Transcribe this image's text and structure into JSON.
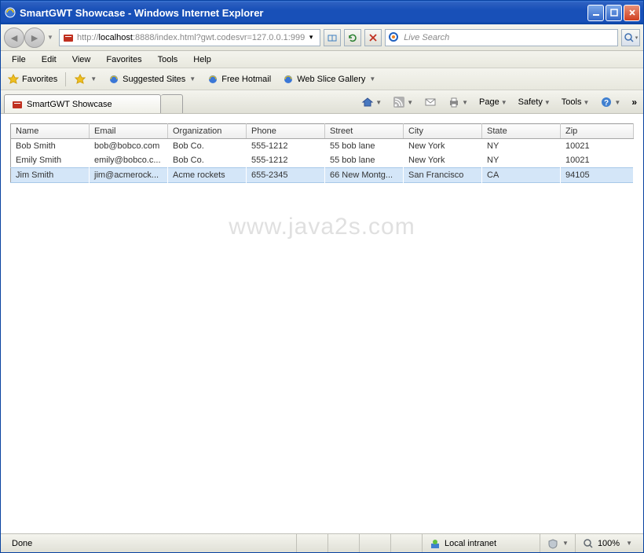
{
  "window": {
    "title": "SmartGWT Showcase - Windows Internet Explorer"
  },
  "nav": {
    "url_prefix": "http://",
    "url_host": "localhost",
    "url_suffix": ":8888/index.html?gwt.codesvr=127.0.0.1:999",
    "search_placeholder": "Live Search"
  },
  "menubar": {
    "file": "File",
    "edit": "Edit",
    "view": "View",
    "favorites": "Favorites",
    "tools": "Tools",
    "help": "Help"
  },
  "favbar": {
    "favorites": "Favorites",
    "suggested": "Suggested Sites",
    "hotmail": "Free Hotmail",
    "webslice": "Web Slice Gallery"
  },
  "tabs": {
    "active": "SmartGWT Showcase"
  },
  "tabtools": {
    "page": "Page",
    "safety": "Safety",
    "tools": "Tools"
  },
  "table": {
    "headers": {
      "name": "Name",
      "email": "Email",
      "organization": "Organization",
      "phone": "Phone",
      "street": "Street",
      "city": "City",
      "state": "State",
      "zip": "Zip"
    },
    "rows": [
      {
        "name": "Bob Smith",
        "email": "bob@bobco.com",
        "organization": "Bob Co.",
        "phone": "555-1212",
        "street": "55 bob lane",
        "city": "New York",
        "state": "NY",
        "zip": "10021"
      },
      {
        "name": "Emily Smith",
        "email": "emily@bobco.c...",
        "organization": "Bob Co.",
        "phone": "555-1212",
        "street": "55 bob lane",
        "city": "New York",
        "state": "NY",
        "zip": "10021"
      },
      {
        "name": "Jim Smith",
        "email": "jim@acmerock...",
        "organization": "Acme rockets",
        "phone": "655-2345",
        "street": "66 New Montg...",
        "city": "San Francisco",
        "state": "CA",
        "zip": "94105"
      }
    ]
  },
  "watermark": "www.java2s.com",
  "statusbar": {
    "status": "Done",
    "zone": "Local intranet",
    "zoom": "100%"
  }
}
